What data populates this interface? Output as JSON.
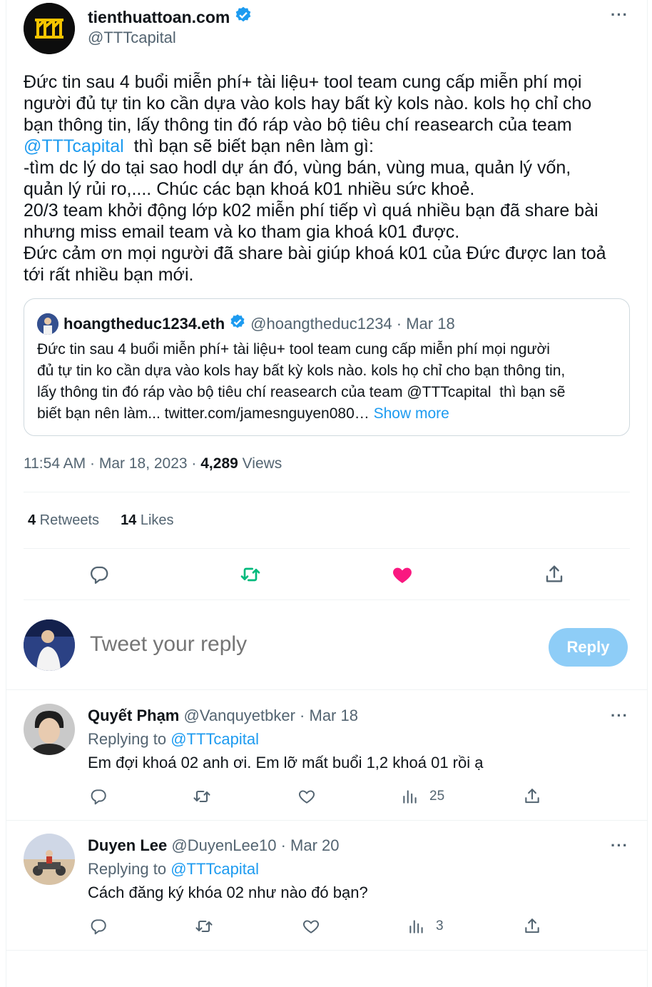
{
  "tweet": {
    "author_name": "tienthuattoan.com",
    "author_handle": "@TTTcapital",
    "text_before_mention": "Đức tin sau 4 buổi miễn phí+ tài liệu+ tool team cung cấp miễn phí mọi\nngười đủ tự tin ko cần dựa vào kols hay bất kỳ kols nào. kols họ chỉ cho\nbạn thông tin, lấy thông tin đó ráp vào bộ tiêu chí reasearch của team\n",
    "mention": "@TTTcapital",
    "text_after_mention": "  thì bạn sẽ biết bạn nên làm gì:\n-tìm dc lý do tại sao hodl dự án đó, vùng bán, vùng mua, quản lý vốn,\nquản lý rủi ro,.... Chúc các bạn khoá k01 nhiều sức khoẻ.\n20/3 team khởi động lớp k02 miễn phí tiếp vì quá nhiều bạn đã share bài\nnhưng miss email team và ko tham gia khoá k01 được.\nĐức cảm ơn mọi người đã share bài giúp khoá k01 của Đức được lan toả\ntới rất nhiều bạn mới.",
    "time": "11:54 AM · Mar 18, 2023 · ",
    "views_count": "4,289",
    "views_label": " Views",
    "retweets_count": "4",
    "retweets_label": " Retweets",
    "likes_count": "14",
    "likes_label": " Likes"
  },
  "quote": {
    "name": "hoangtheduc1234.eth",
    "meta": "@hoangtheduc1234 · Mar 18",
    "text": "Đức tin sau 4 buổi miễn phí+ tài liệu+ tool team cung cấp miễn phí mọi người\nđủ tự tin ko cần dựa vào kols hay bất kỳ kols nào. kols họ chỉ cho bạn thông tin,\nlấy thông tin đó ráp vào bộ tiêu chí reasearch của team @TTTcapital  thì bạn sẽ\nbiết bạn nên làm... twitter.com/jamesnguyen080… ",
    "show_more": "Show more"
  },
  "composer": {
    "placeholder": "Tweet your reply",
    "reply_label": "Reply"
  },
  "replies": [
    {
      "name": "Quyết Phạm",
      "meta": " @Vanquyetbker · Mar 18",
      "replying_label": "Replying to ",
      "replying_to": "@TTTcapital",
      "text": "Em đợi khoá 02 anh ơi. Em lỡ mất buổi 1,2 khoá 01 rồi ạ",
      "views": "25"
    },
    {
      "name": "Duyen Lee",
      "meta": " @DuyenLee10 · Mar 20",
      "replying_label": "Replying to ",
      "replying_to": "@TTTcapital",
      "text": "Cách đăng ký khóa 02 như nào đó bạn?",
      "views": "3"
    }
  ],
  "colors": {
    "accent": "#1d9bf0",
    "retweet_active": "#00ba7c",
    "like_active": "#f91880",
    "reply_button_disabled": "#8ecdf7",
    "secondary_text": "#536471"
  }
}
